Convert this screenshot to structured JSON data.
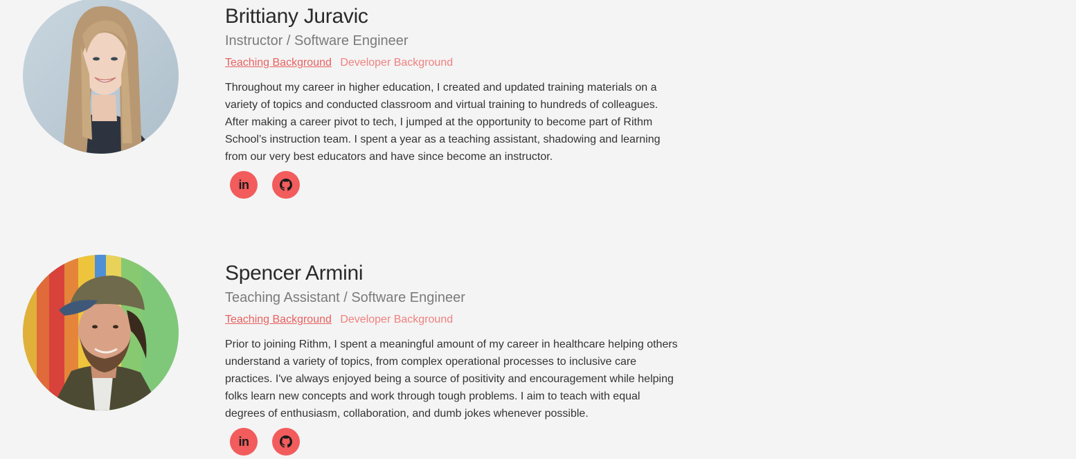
{
  "profiles": [
    {
      "name": "Brittiany Juravic",
      "role": "Instructor / Software Engineer",
      "tabs": [
        "Teaching Background",
        "Developer Background"
      ],
      "active_tab": "Teaching Background",
      "bio": "Throughout my career in higher education, I created and updated training materials on a variety of topics and conducted classroom and virtual training to hundreds of colleagues. After making a career pivot to tech, I jumped at the opportunity to become part of Rithm School’s instruction team. I spent a year as a teaching assistant, shadowing and learning from our very best educators and have since become an instructor.",
      "socials": [
        {
          "icon": "linkedin-icon",
          "label": "in"
        },
        {
          "icon": "github-icon"
        }
      ]
    },
    {
      "name": "Spencer Armini",
      "role": "Teaching Assistant / Software Engineer",
      "tabs": [
        "Teaching Background",
        "Developer Background"
      ],
      "active_tab": "Teaching Background",
      "bio": "Prior to joining Rithm, I spent a meaningful amount of my career in healthcare helping others understand a variety of topics, from complex operational processes to inclusive care practices. I've always enjoyed being a source of positivity and encouragement while helping folks learn new concepts and work through tough problems. I aim to teach with equal degrees of enthusiasm, collaboration, and dumb jokes whenever possible.",
      "socials": [
        {
          "icon": "linkedin-icon",
          "label": "in"
        },
        {
          "icon": "github-icon"
        }
      ]
    }
  ],
  "colors": {
    "background": "#f4f4f4",
    "accent": "#f25c5c",
    "tab_link": "#f08080",
    "tab_active": "#e86060",
    "role_text": "#7a7a7a"
  }
}
